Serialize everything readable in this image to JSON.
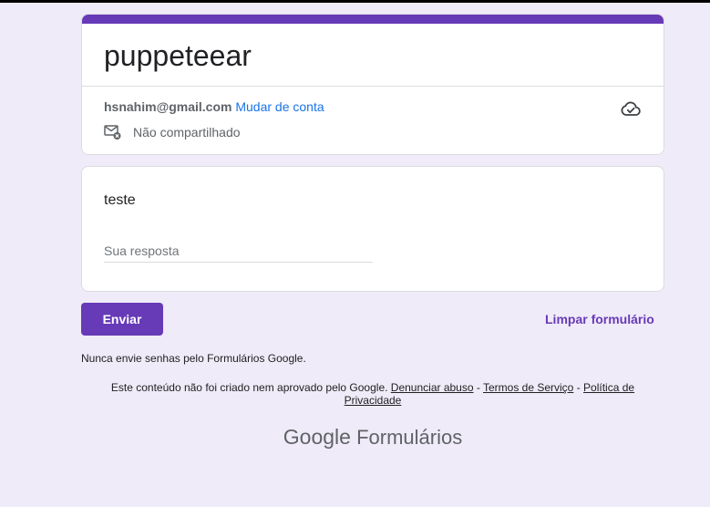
{
  "form": {
    "title": "puppeteear",
    "accent_color": "#673ab7",
    "background_color": "#f0ebf8"
  },
  "account": {
    "email": "hsnahim@gmail.com",
    "switch_label": "Mudar de conta",
    "share_status": "Não compartilhado",
    "cloud_icon": "cloud-check-icon",
    "share_icon": "mail-not-shared-icon"
  },
  "question": {
    "title": "teste",
    "placeholder": "Sua resposta",
    "value": ""
  },
  "actions": {
    "submit_label": "Enviar",
    "clear_label": "Limpar formulário"
  },
  "footer": {
    "password_warning": "Nunca envie senhas pelo Formulários Google.",
    "disclaimer": "Este conteúdo não foi criado nem aprovado pelo Google.",
    "report_abuse": "Denunciar abuso",
    "terms": "Termos de Serviço",
    "privacy": "Política de Privacidade",
    "separator": " - ",
    "logo_google": "Google",
    "logo_forms": "Formulários"
  }
}
